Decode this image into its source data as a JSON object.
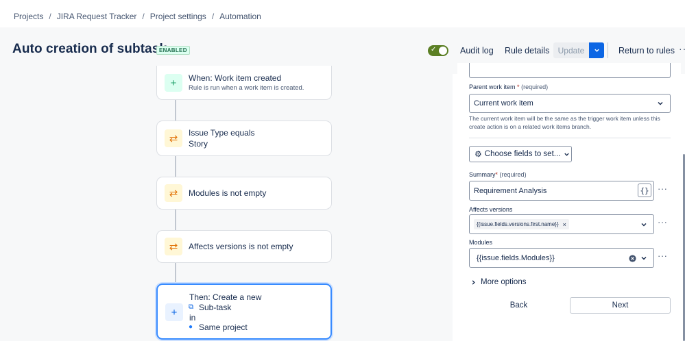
{
  "breadcrumb": {
    "items": [
      "Projects",
      "JIRA Request Tracker",
      "Project settings",
      "Automation"
    ],
    "separator": "/"
  },
  "header": {
    "title": "Auto creation of subtask",
    "status_badge": "ENABLED",
    "toggle_enabled": true,
    "audit_log": "Audit log",
    "rule_details": "Rule details",
    "update": "Update",
    "return_to_rules": "Return to rules",
    "more": "···"
  },
  "flow": {
    "trigger": {
      "title": "When: Work item created",
      "subtitle": "Rule is run when a work item is created."
    },
    "conditions": [
      {
        "line1": "Issue Type equals",
        "line2": "Story"
      },
      {
        "line1": "Modules is not empty"
      },
      {
        "line1": "Affects versions is not empty"
      }
    ],
    "action": {
      "line1": "Then: Create a new",
      "line2": "Sub-task",
      "line3": "in",
      "line4": "Same project"
    }
  },
  "panel": {
    "parent_label": "Parent work item",
    "required_star": "*",
    "required_text": "(required)",
    "parent_value": "Current work item",
    "parent_helper": "The current work item will be the same as the trigger work item unless this create action is on a related work items branch.",
    "choose_fields": "Choose fields to set...",
    "summary_label": "Summary",
    "summary_value": "Requirement Analysis",
    "smart_value_icon": "{}",
    "affects_label": "Affects versions",
    "affects_tag": "{{issue.fields.versions.first.name}}",
    "tag_remove": "×",
    "modules_label": "Modules",
    "modules_value": "{{issue.fields.Modules}}",
    "more_options": "More options",
    "back": "Back",
    "next": "Next",
    "field_more": "···"
  },
  "colors": {
    "primary": "#0c66e4",
    "toggle_on": "#5b7f24",
    "badge_bg": "#dcfff1",
    "condition_icon": "#e2740a",
    "trigger_icon": "#22a06b"
  }
}
